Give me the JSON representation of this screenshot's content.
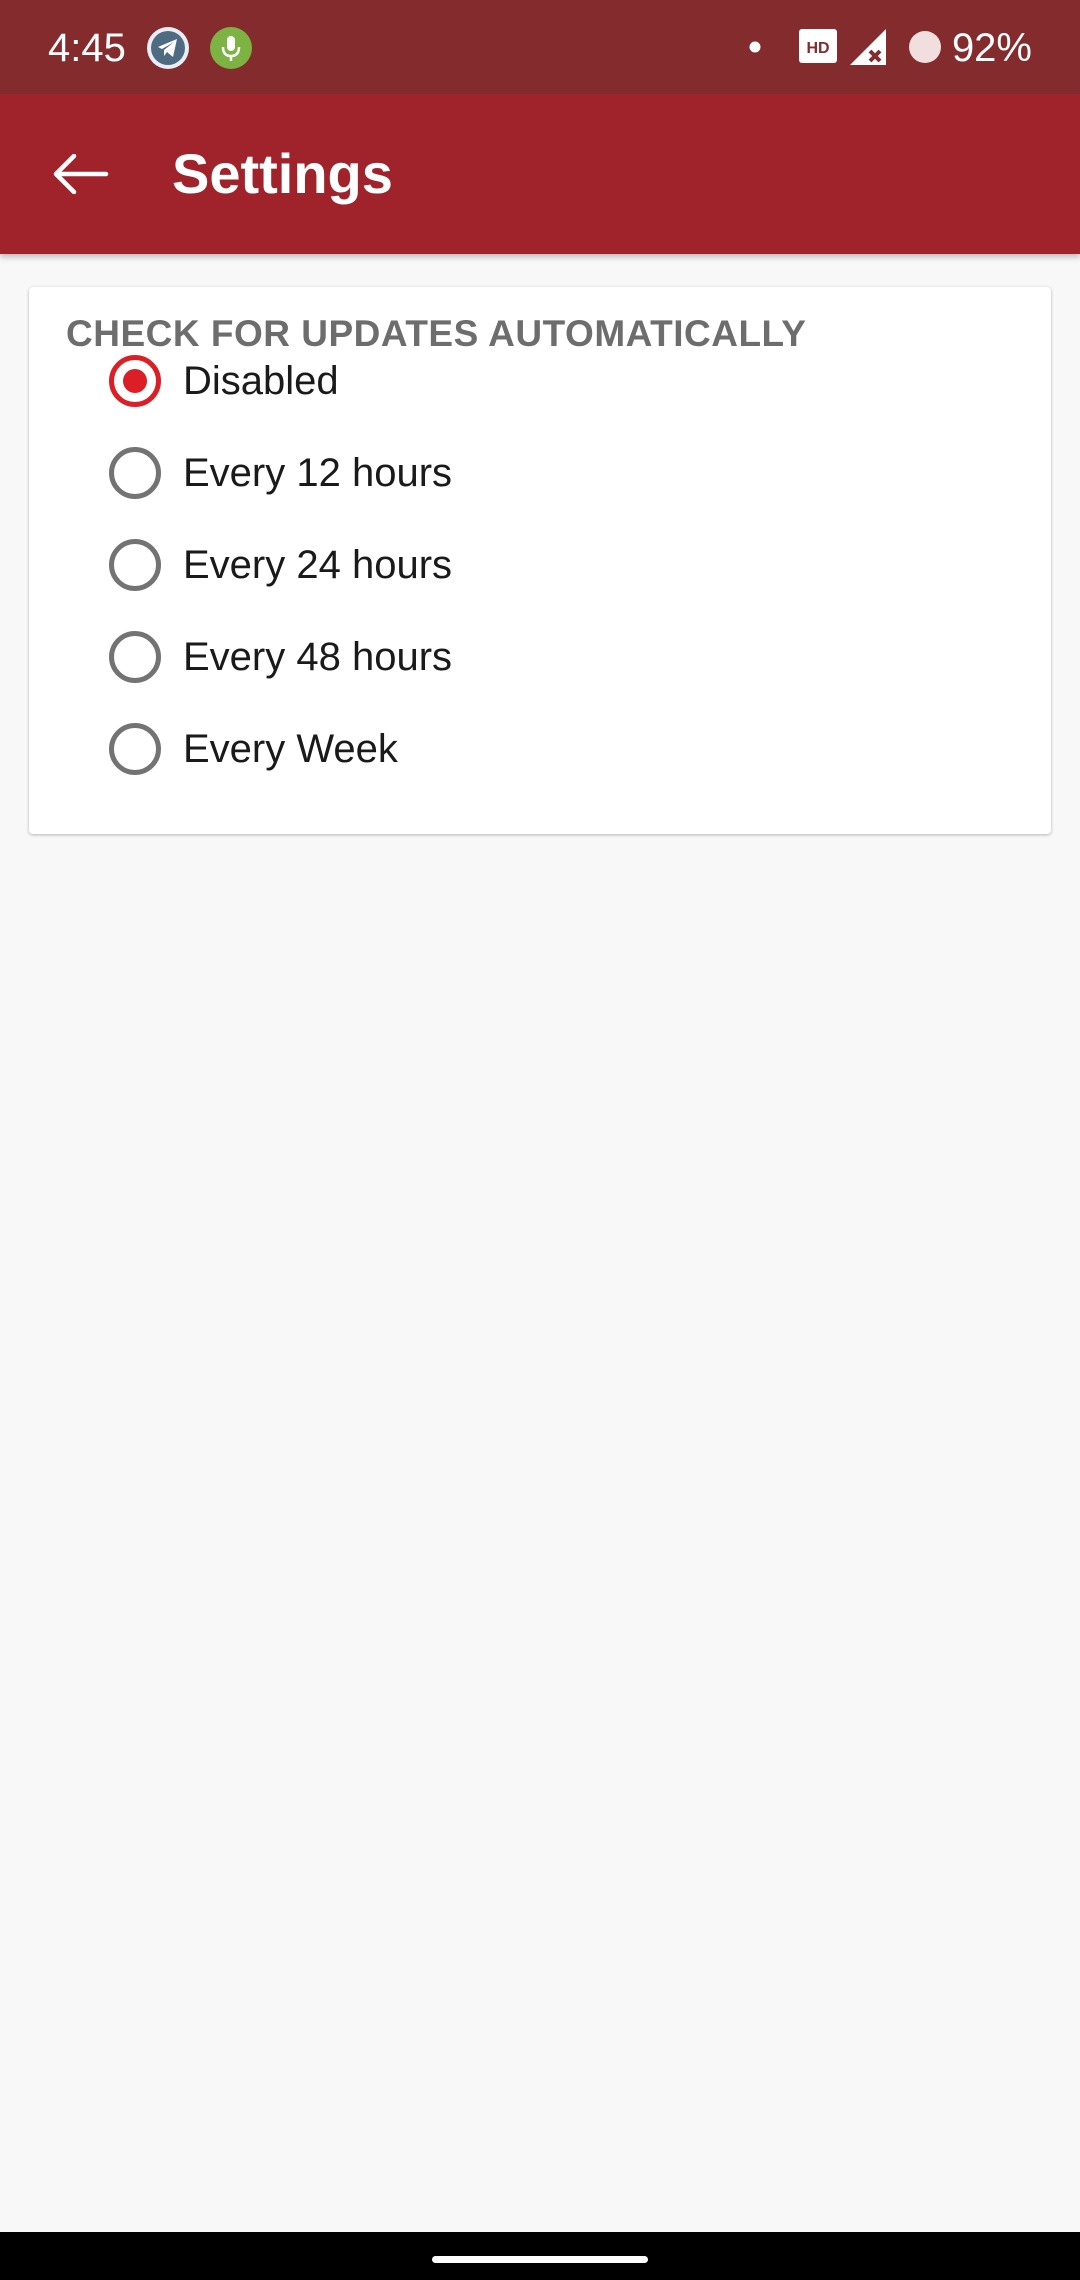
{
  "status_bar": {
    "time": "4:45",
    "battery": "92%",
    "icons": [
      "telegram-icon",
      "microphone-icon",
      "notification-dot-icon",
      "hd-icon",
      "signal-no-service-icon",
      "battery-saver-icon"
    ]
  },
  "app_bar": {
    "title": "Settings",
    "back_icon": "back-arrow-icon"
  },
  "card": {
    "header": "CHECK FOR UPDATES AUTOMATICALLY",
    "options": [
      {
        "label": "Disabled",
        "selected": true
      },
      {
        "label": "Every 12 hours",
        "selected": false
      },
      {
        "label": "Every 24 hours",
        "selected": false
      },
      {
        "label": "Every 48 hours",
        "selected": false
      },
      {
        "label": "Every Week",
        "selected": false
      }
    ]
  },
  "colors": {
    "status_bar": "#842b2e",
    "app_bar": "#a0232b",
    "accent": "#dc1f26",
    "background": "#f8f8f8",
    "header_text": "#6d6d6d"
  }
}
